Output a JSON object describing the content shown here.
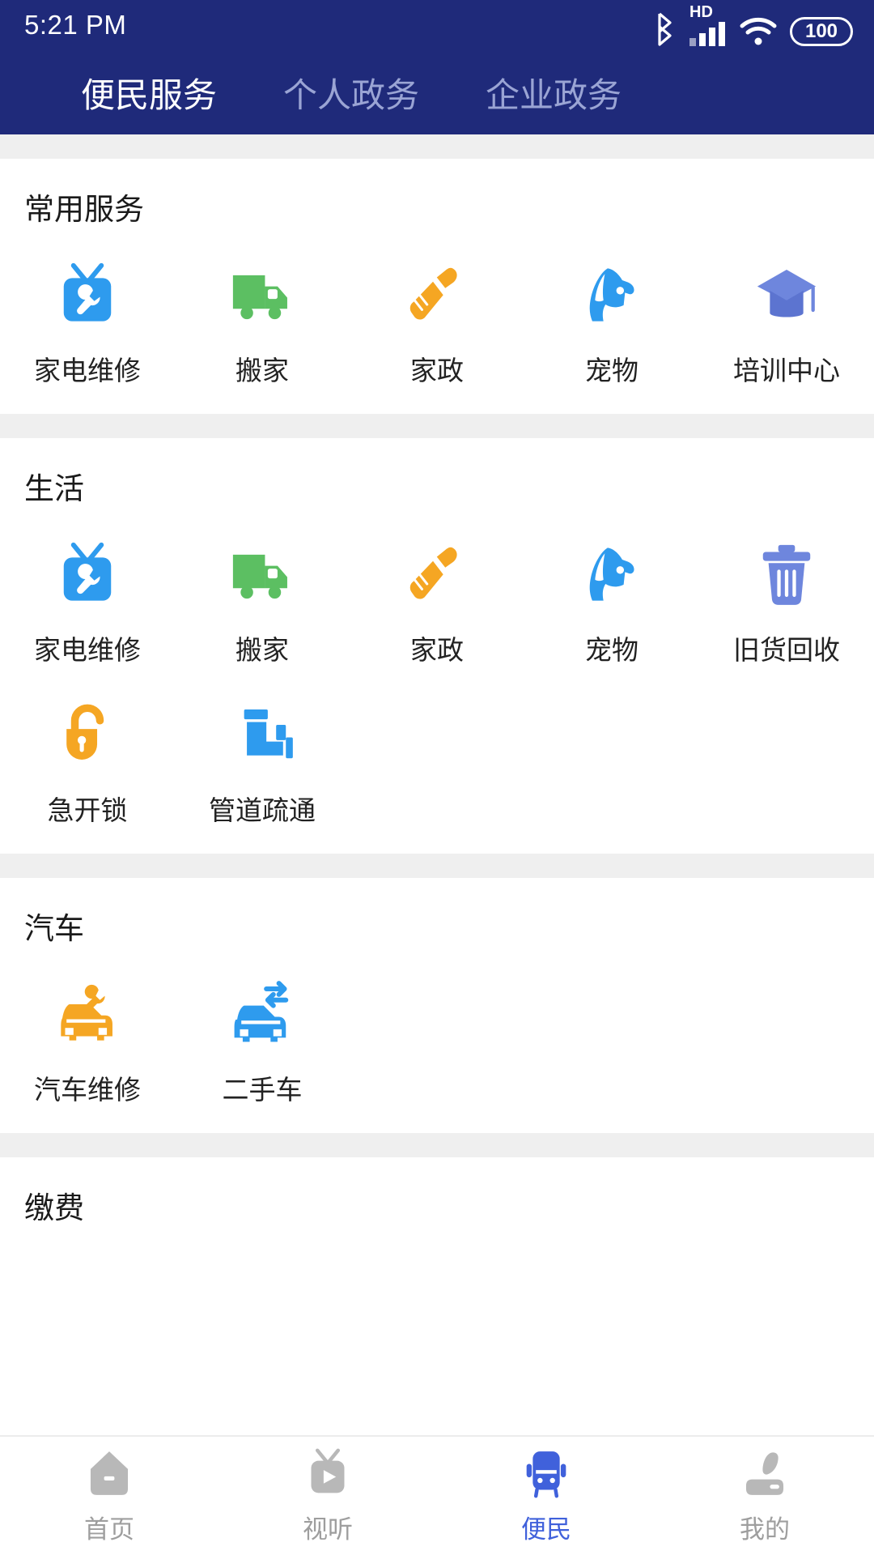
{
  "status_bar": {
    "time": "5:21 PM",
    "hd_label": "HD",
    "battery_level": "100",
    "icons": [
      "bluetooth-icon",
      "hd-signal-icon",
      "wifi-icon",
      "battery-icon"
    ]
  },
  "header": {
    "tabs": [
      {
        "label": "便民服务",
        "active": true
      },
      {
        "label": "个人政务",
        "active": false
      },
      {
        "label": "企业政务",
        "active": false
      }
    ]
  },
  "colors": {
    "header_bg": "#1F2A7A",
    "divider": "#EFEFEF",
    "accent_active": "#4061DB",
    "icon_blue": "#2E9BEE",
    "icon_green": "#5CBF62",
    "icon_orange": "#F5A623",
    "icon_periwinkle": "#6E86DD",
    "nav_inactive": "#B8B8B8"
  },
  "sections": [
    {
      "title": "常用服务",
      "items": [
        {
          "label": "家电维修",
          "icon": "tv-wrench-icon",
          "color": "#2E9BEE"
        },
        {
          "label": "搬家",
          "icon": "moving-truck-icon",
          "color": "#5CBF62"
        },
        {
          "label": "家政",
          "icon": "cleaning-brush-icon",
          "color": "#F5A623"
        },
        {
          "label": "宠物",
          "icon": "dog-icon",
          "color": "#2E9BEE"
        },
        {
          "label": "培训中心",
          "icon": "graduation-cap-icon",
          "color": "#6E86DD"
        }
      ]
    },
    {
      "title": "生活",
      "items": [
        {
          "label": "家电维修",
          "icon": "tv-wrench-icon",
          "color": "#2E9BEE"
        },
        {
          "label": "搬家",
          "icon": "moving-truck-icon",
          "color": "#5CBF62"
        },
        {
          "label": "家政",
          "icon": "cleaning-brush-icon",
          "color": "#F5A623"
        },
        {
          "label": "宠物",
          "icon": "dog-icon",
          "color": "#2E9BEE"
        },
        {
          "label": "旧货回收",
          "icon": "trash-bin-icon",
          "color": "#6E86DD"
        },
        {
          "label": "急开锁",
          "icon": "open-padlock-icon",
          "color": "#F5A623"
        },
        {
          "label": "管道疏通",
          "icon": "pipe-icon",
          "color": "#2E9BEE"
        }
      ]
    },
    {
      "title": "汽车",
      "items": [
        {
          "label": "汽车维修",
          "icon": "car-wrench-icon",
          "color": "#F5A623"
        },
        {
          "label": "二手车",
          "icon": "car-exchange-icon",
          "color": "#2E9BEE"
        }
      ]
    },
    {
      "title": "缴费",
      "items": []
    }
  ],
  "bottom_nav": [
    {
      "label": "首页",
      "icon": "home-icon",
      "active": false
    },
    {
      "label": "视听",
      "icon": "tv-play-icon",
      "active": false
    },
    {
      "label": "便民",
      "icon": "bus-icon",
      "active": true
    },
    {
      "label": "我的",
      "icon": "person-icon",
      "active": false
    }
  ]
}
